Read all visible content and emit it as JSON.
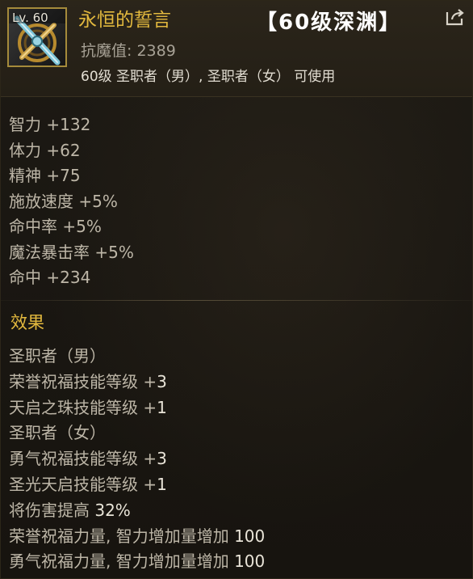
{
  "header": {
    "level_label": "Lv. 60",
    "item_name": "永恒的誓言",
    "level_tag": "【60级深渊】",
    "resist_text": "抗魔值: 2389",
    "usable_text": "60级 圣职者（男）, 圣职者（女） 可使用"
  },
  "colors": {
    "title_gold": "#e3b93e",
    "text_gray": "#bdb6a7",
    "frame_gold": "#a58b3b"
  },
  "icons": [
    "share-icon",
    "cross-weapon-icon"
  ],
  "stats": [
    "智力 +132",
    "体力 +62",
    "精神 +75",
    "施放速度 +5%",
    "命中率 +5%",
    "魔法暴击率 +5%",
    "命中 +234"
  ],
  "effects": {
    "title": "效果",
    "lines": [
      {
        "label": "圣职者（男）",
        "value": ""
      },
      {
        "label": "荣誉祝福技能等级 +",
        "value": "3"
      },
      {
        "label": "天启之珠技能等级 +",
        "value": "1"
      },
      {
        "label": "圣职者（女）",
        "value": ""
      },
      {
        "label": "勇气祝福技能等级 +",
        "value": "3"
      },
      {
        "label": "圣光天启技能等级 +",
        "value": "1"
      },
      {
        "label": "将伤害提高 ",
        "value": "32%"
      },
      {
        "label": "荣誉祝福力量, 智力增加量增加 ",
        "value": "100"
      },
      {
        "label": "勇气祝福力量, 智力增加量增加 ",
        "value": "100"
      }
    ]
  }
}
